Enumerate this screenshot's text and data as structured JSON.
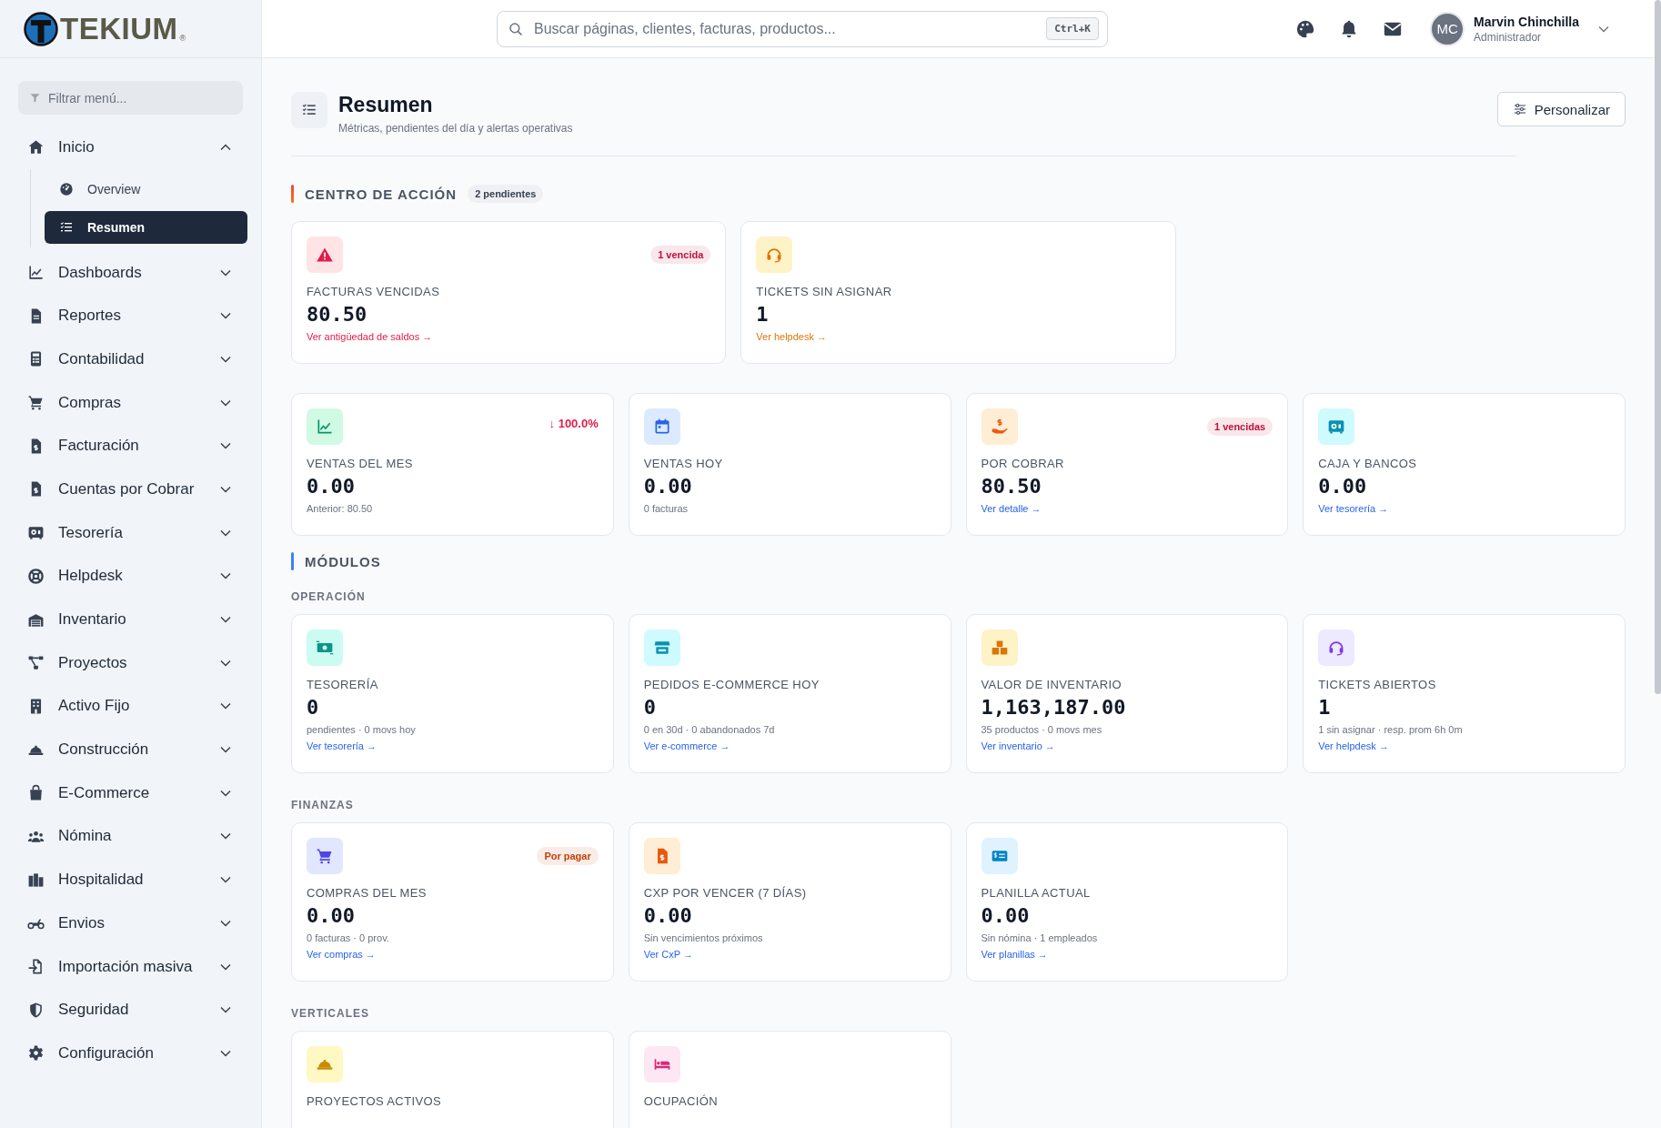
{
  "logo": {
    "text": "TEKIUM",
    "mark": "®"
  },
  "sidebar": {
    "filter": {
      "placeholder": "Filtrar menú..."
    },
    "items": [
      {
        "label": "Inicio",
        "expanded": true,
        "children": [
          {
            "label": "Overview",
            "selected": false
          },
          {
            "label": "Resumen",
            "selected": true
          }
        ]
      },
      {
        "label": "Dashboards",
        "expanded": false
      },
      {
        "label": "Reportes",
        "expanded": false
      },
      {
        "label": "Contabilidad",
        "expanded": false
      },
      {
        "label": "Compras",
        "expanded": false
      },
      {
        "label": "Facturación",
        "expanded": false
      },
      {
        "label": "Cuentas por Cobrar",
        "expanded": false
      },
      {
        "label": "Tesorería",
        "expanded": false
      },
      {
        "label": "Helpdesk",
        "expanded": false
      },
      {
        "label": "Inventario",
        "expanded": false
      },
      {
        "label": "Proyectos",
        "expanded": false
      },
      {
        "label": "Activo Fijo",
        "expanded": false
      },
      {
        "label": "Construcción",
        "expanded": false
      },
      {
        "label": "E-Commerce",
        "expanded": false
      },
      {
        "label": "Nómina",
        "expanded": false
      },
      {
        "label": "Hospitalidad",
        "expanded": false
      },
      {
        "label": "Envios",
        "expanded": false
      },
      {
        "label": "Importación masiva",
        "expanded": false
      },
      {
        "label": "Seguridad",
        "expanded": false
      },
      {
        "label": "Configuración",
        "expanded": false
      }
    ]
  },
  "header": {
    "search": {
      "placeholder": "Buscar páginas, clientes, facturas, productos...",
      "shortcut": "Ctrl+K"
    },
    "user": {
      "initials": "MC",
      "name": "Marvin Chinchilla",
      "role": "Administrador"
    }
  },
  "page": {
    "title": "Resumen",
    "subtitle": "Métricas, pendientes del día y alertas operativas",
    "button": "Personalizar"
  },
  "action_center": {
    "title": "CENTRO DE ACCIÓN",
    "count": "2 pendientes",
    "cards": [
      {
        "label": "FACTURAS VENCIDAS",
        "value": "80.50",
        "link": "Ver antigüedad de saldos →",
        "color": "#e11d48",
        "badge": {
          "text": "1 vencida",
          "kind": "pill",
          "color": "#be123c"
        }
      },
      {
        "label": "TICKETS SIN ASIGNAR",
        "value": "1",
        "link": "Ver helpdesk →",
        "color": "#d97706"
      }
    ]
  },
  "kpis": [
    {
      "label": "VENTAS DEL MES",
      "value": "0.00",
      "sub": "Anterior: 80.50",
      "badge": {
        "text": "↓ 100.0%",
        "kind": "trend",
        "color": "#e11d48"
      }
    },
    {
      "label": "VENTAS HOY",
      "value": "0.00",
      "sub": "0 facturas"
    },
    {
      "label": "POR COBRAR",
      "value": "80.50",
      "link": "Ver detalle →",
      "badge": {
        "text": "1 vencidas",
        "kind": "pill",
        "color": "#be123c"
      }
    },
    {
      "label": "CAJA Y BANCOS",
      "value": "0.00",
      "link": "Ver tesorería →"
    }
  ],
  "modules": {
    "title": "MÓDULOS",
    "groups": [
      {
        "title": "OPERACIÓN",
        "cards": [
          {
            "label": "TESORERÍA",
            "value": "0",
            "sub": "pendientes · 0 movs hoy",
            "link": "Ver tesorería →"
          },
          {
            "label": "PEDIDOS E-COMMERCE HOY",
            "value": "0",
            "sub": "0 en 30d · 0 abandonados 7d",
            "link": "Ver e-commerce →"
          },
          {
            "label": "VALOR DE INVENTARIO",
            "value": "1,163,187.00",
            "sub": "35 productos · 0 movs mes",
            "link": "Ver inventario →"
          },
          {
            "label": "TICKETS ABIERTOS",
            "value": "1",
            "sub": "1 sin asignar · resp. prom 6h 0m",
            "link": "Ver helpdesk →"
          }
        ]
      },
      {
        "title": "FINANZAS",
        "cards": [
          {
            "label": "COMPRAS DEL MES",
            "value": "0.00",
            "sub": "0 facturas · 0 prov.",
            "link": "Ver compras →",
            "badge": {
              "text": "Por pagar",
              "kind": "pill",
              "color": "#c2410c"
            }
          },
          {
            "label": "CXP POR VENCER (7 DÍAS)",
            "value": "0.00",
            "sub": "Sin vencimientos próximos",
            "link": "Ver CxP →"
          },
          {
            "label": "PLANILLA ACTUAL",
            "value": "0.00",
            "sub": "Sin nómina · 1 empleados",
            "link": "Ver planillas →"
          }
        ]
      },
      {
        "title": "VERTICALES",
        "cards": [
          {
            "label": "PROYECTOS ACTIVOS"
          },
          {
            "label": "OCUPACIÓN"
          }
        ]
      }
    ]
  }
}
